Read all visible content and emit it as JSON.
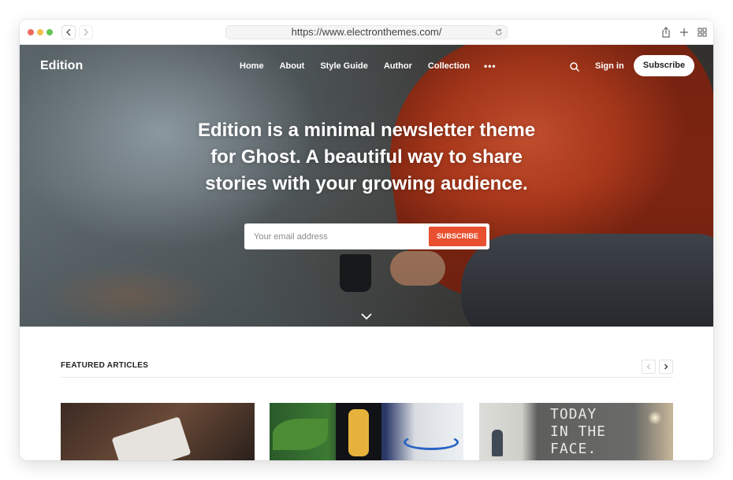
{
  "browser": {
    "url": "https://www.electronthemes.com/",
    "traffic_colors": {
      "close": "#ec6a5e",
      "minimize": "#f4bf4f",
      "zoom": "#61c554"
    },
    "icons": {
      "back": "chevron-left-icon",
      "forward": "chevron-right-icon",
      "reload": "reload-icon",
      "share": "share-icon",
      "new_tab": "plus-icon",
      "tabs": "tab-overview-icon"
    }
  },
  "site": {
    "logo": "Edition",
    "nav": [
      "Home",
      "About",
      "Style Guide",
      "Author",
      "Collection"
    ],
    "more": "•••",
    "signin": "Sign in",
    "subscribe": "Subscribe"
  },
  "hero": {
    "lines": [
      "Edition is a minimal newsletter theme",
      "for Ghost. A beautiful way to share",
      "stories with your growing audience."
    ],
    "email_placeholder": "Your email address",
    "submit_label": "SUBSCRIBE",
    "accent_color": "#e8502f"
  },
  "featured": {
    "title": "FEATURED ARTICLES",
    "card3_wall_text": [
      "TODAY",
      "IN THE",
      "FACE."
    ]
  }
}
